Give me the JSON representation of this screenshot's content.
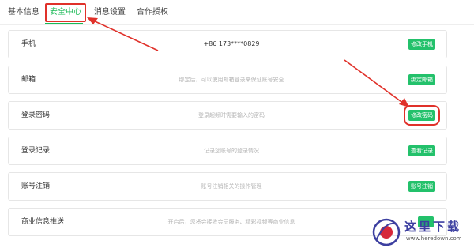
{
  "tabs": [
    {
      "label": "基本信息"
    },
    {
      "label": "安全中心",
      "active": true
    },
    {
      "label": "消息设置"
    },
    {
      "label": "合作授权"
    }
  ],
  "rows": [
    {
      "label": "手机",
      "desc": "+86 173****0829",
      "button": "修改手机"
    },
    {
      "label": "邮箱",
      "desc": "绑定后，可以使用邮箱登录来保证账号安全",
      "button": "绑定邮箱"
    },
    {
      "label": "登录密码",
      "desc": "登录超频时需要输入的密码",
      "button": "修改密码"
    },
    {
      "label": "登录记录",
      "desc": "记录您账号的登录情况",
      "button": "查看记录"
    },
    {
      "label": "账号注销",
      "desc": "账号注销相关的操作管理",
      "button": "账号注销"
    },
    {
      "label": "商业信息推送",
      "desc": "开启后，您将会接收会员服务、精彩视频等商业信息",
      "button": ""
    }
  ],
  "watermark": {
    "title": "这里下载",
    "url": "www.heredown.com"
  },
  "colors": {
    "accent": "#19b955",
    "button": "#23c16b",
    "annotation": "#e0312a"
  }
}
